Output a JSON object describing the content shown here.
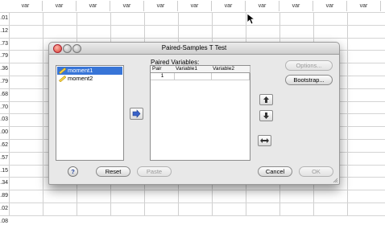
{
  "spreadsheet": {
    "column_header": "var",
    "columns_count": 11,
    "row_values": [
      ".01",
      ".12",
      ".73",
      ".79",
      ".36",
      ".79",
      ".68",
      ".70",
      ".03",
      ".00",
      ".62",
      ".57",
      ".15",
      ".34",
      ".89",
      ".02",
      ".08"
    ]
  },
  "dialog": {
    "title": "Paired-Samples T Test",
    "variables": [
      {
        "name": "moment1",
        "selected": true,
        "icon": "ruler-scale-icon"
      },
      {
        "name": "moment2",
        "selected": false,
        "icon": "ruler-scale-icon"
      }
    ],
    "paired_variables_label": "Paired Variables:",
    "table_headers": [
      "Pair",
      "Variable1",
      "Variable2"
    ],
    "rows": [
      {
        "pair": "1",
        "variable1": "",
        "variable2": ""
      }
    ],
    "buttons": {
      "options": "Options...",
      "bootstrap": "Bootstrap...",
      "reset": "Reset",
      "paste": "Paste",
      "cancel": "Cancel",
      "ok": "OK",
      "help": "?"
    },
    "button_states": {
      "options": "disabled",
      "paste": "disabled",
      "ok": "disabled"
    },
    "colors": {
      "selection": "#3875d7",
      "help_icon": "#1b3d9a"
    }
  }
}
